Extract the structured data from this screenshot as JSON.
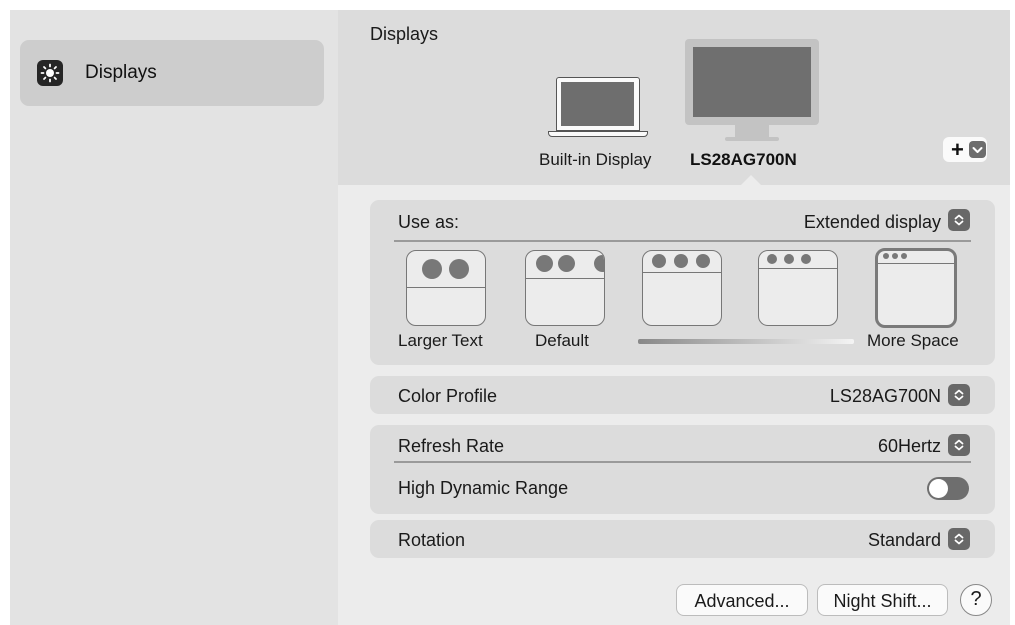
{
  "sidebar": {
    "items": [
      {
        "label": "Displays",
        "icon": "brightness-icon",
        "selected": true
      }
    ]
  },
  "header": {
    "title": "Displays",
    "displays": [
      {
        "name": "Built-in Display",
        "icon": "laptop-icon",
        "selected": false
      },
      {
        "name": "LS28AG700N",
        "icon": "monitor-icon",
        "selected": true
      }
    ],
    "add_button": {
      "label": "+",
      "icon": "chevron-down-icon"
    }
  },
  "use_as": {
    "label": "Use as:",
    "value": "Extended display",
    "resolution_options": [
      {
        "label": "Larger Text"
      },
      {
        "label": "Default"
      },
      {
        "label": ""
      },
      {
        "label": ""
      },
      {
        "label": "More Space",
        "selected": true
      }
    ]
  },
  "color_profile": {
    "label": "Color Profile",
    "value": "LS28AG700N"
  },
  "refresh_rate": {
    "label": "Refresh Rate",
    "value": "60Hertz"
  },
  "hdr": {
    "label": "High Dynamic Range",
    "enabled": false
  },
  "rotation": {
    "label": "Rotation",
    "value": "Standard"
  },
  "footer": {
    "advanced": "Advanced...",
    "night_shift": "Night Shift...",
    "help": "?"
  },
  "colors": {
    "accent": "#6e6e6e",
    "panel": "#dcdcdc",
    "sidebar_selected": "#cdcdcd"
  }
}
